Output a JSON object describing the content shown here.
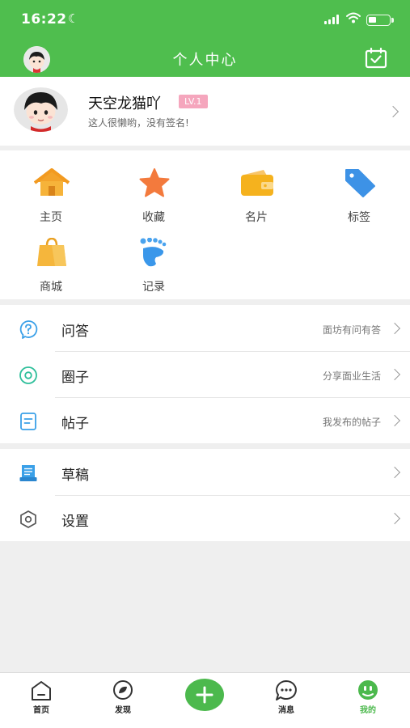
{
  "status_bar": {
    "time": "16:22"
  },
  "nav": {
    "title": "个人中心"
  },
  "profile": {
    "name": "天空龙猫吖",
    "level": "LV.1",
    "signature": "这人很懒哟，没有签名!"
  },
  "grid": [
    {
      "label": "主页",
      "icon": "home-icon"
    },
    {
      "label": "收藏",
      "icon": "star-icon"
    },
    {
      "label": "名片",
      "icon": "wallet-card-icon"
    },
    {
      "label": "标签",
      "icon": "tag-icon"
    },
    {
      "label": "商城",
      "icon": "shopping-bag-icon"
    },
    {
      "label": "记录",
      "icon": "footprint-icon"
    }
  ],
  "menu": [
    {
      "title": "问答",
      "subtitle": "面坊有问有答",
      "icon": "question-icon"
    },
    {
      "title": "圈子",
      "subtitle": "分享面业生活",
      "icon": "eye-circle-icon"
    },
    {
      "title": "帖子",
      "subtitle": "我发布的帖子",
      "icon": "note-icon"
    }
  ],
  "menu2": [
    {
      "title": "草稿",
      "icon": "draft-icon"
    },
    {
      "title": "设置",
      "icon": "settings-hexagon-icon"
    }
  ],
  "tabs": [
    {
      "label": "首页"
    },
    {
      "label": "发现"
    },
    {
      "label": "消息"
    },
    {
      "label": "我的"
    }
  ],
  "colors": {
    "brand_green": "#4fbe4e",
    "level_badge": "#f5a6bd",
    "active_tab": "#4cb94d"
  }
}
